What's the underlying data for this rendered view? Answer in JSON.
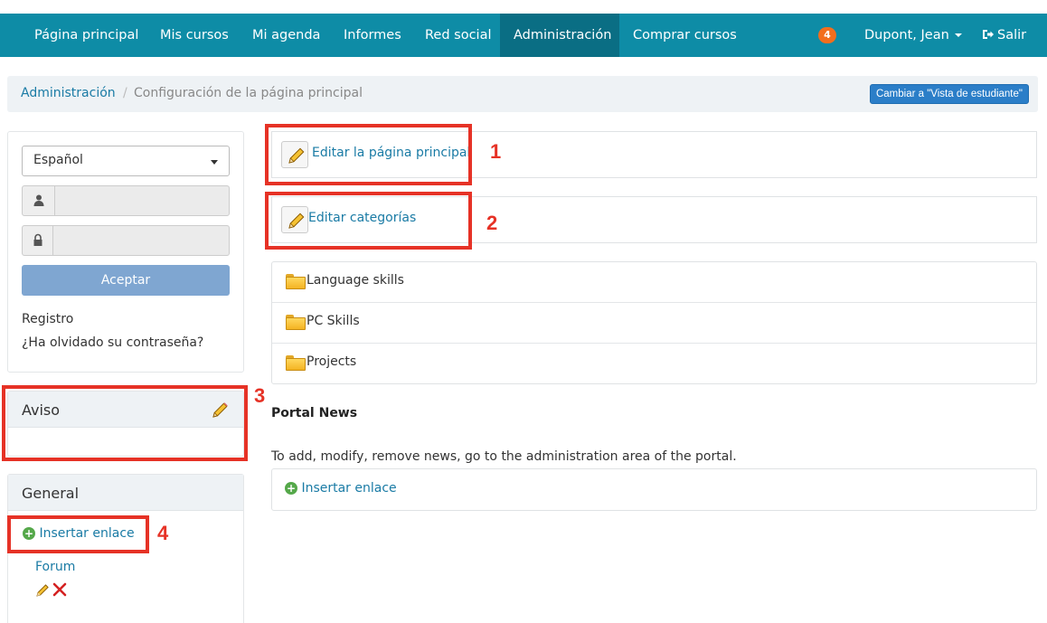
{
  "nav": {
    "items": [
      "Página principal",
      "Mis cursos",
      "Mi agenda",
      "Informes",
      "Red social",
      "Administración",
      "Comprar cursos"
    ],
    "notification_count": "4",
    "user": "Dupont, Jean",
    "logout": "Salir"
  },
  "breadcrumb": {
    "link": "Administración",
    "separator": "/",
    "current": "Configuración de la página principal",
    "student_view_button": "Cambiar a \"Vista de estudiante\""
  },
  "login": {
    "language": "Español",
    "username_value": "",
    "password_value": "",
    "submit": "Aceptar",
    "register": "Registro",
    "forgot": "¿Ha olvidado su contraseña?"
  },
  "notice": {
    "title": "Aviso"
  },
  "general": {
    "title": "General",
    "insert_link": "Insertar enlace",
    "forum_link": "Forum"
  },
  "main": {
    "edit_home": "Editar la página principal",
    "edit_categories": "Editar categorías",
    "categories": [
      "Language skills",
      "PC Skills",
      "Projects"
    ],
    "news_title": "Portal News",
    "news_text": "To add, modify, remove news, go to the administration area of the portal.",
    "insert_link": "Insertar enlace"
  },
  "annotations": [
    "1",
    "2",
    "3",
    "4"
  ],
  "colors": {
    "navbar": "#0e8ca6",
    "accent": "#1a7ba5",
    "annotation": "#e63226"
  }
}
